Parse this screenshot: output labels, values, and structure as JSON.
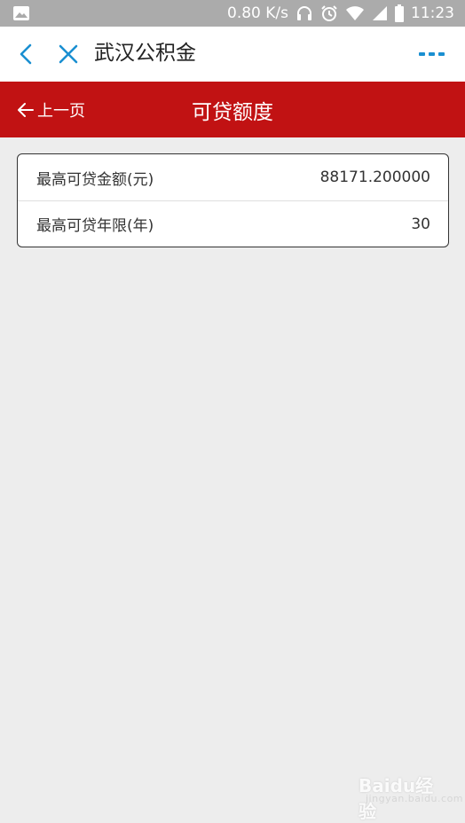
{
  "status_bar": {
    "net_speed": "0.80 K/s",
    "time": "11:23"
  },
  "browser_header": {
    "title": "武汉公积金",
    "icons": {
      "back": "chevron-left-icon",
      "close": "close-icon",
      "more": "more-dots-icon"
    },
    "accent_color": "#1a8fd1"
  },
  "page_bar": {
    "prev_label": "上一页",
    "title": "可贷额度",
    "background_color": "#c11213"
  },
  "loan_info": {
    "rows": [
      {
        "label": "最高可贷金额(元)",
        "value": "88171.200000"
      },
      {
        "label": "最高可贷年限(年)",
        "value": "30"
      }
    ]
  },
  "watermark": {
    "brand": "Baidu经验",
    "sub": "jingyan.baidu.com"
  }
}
